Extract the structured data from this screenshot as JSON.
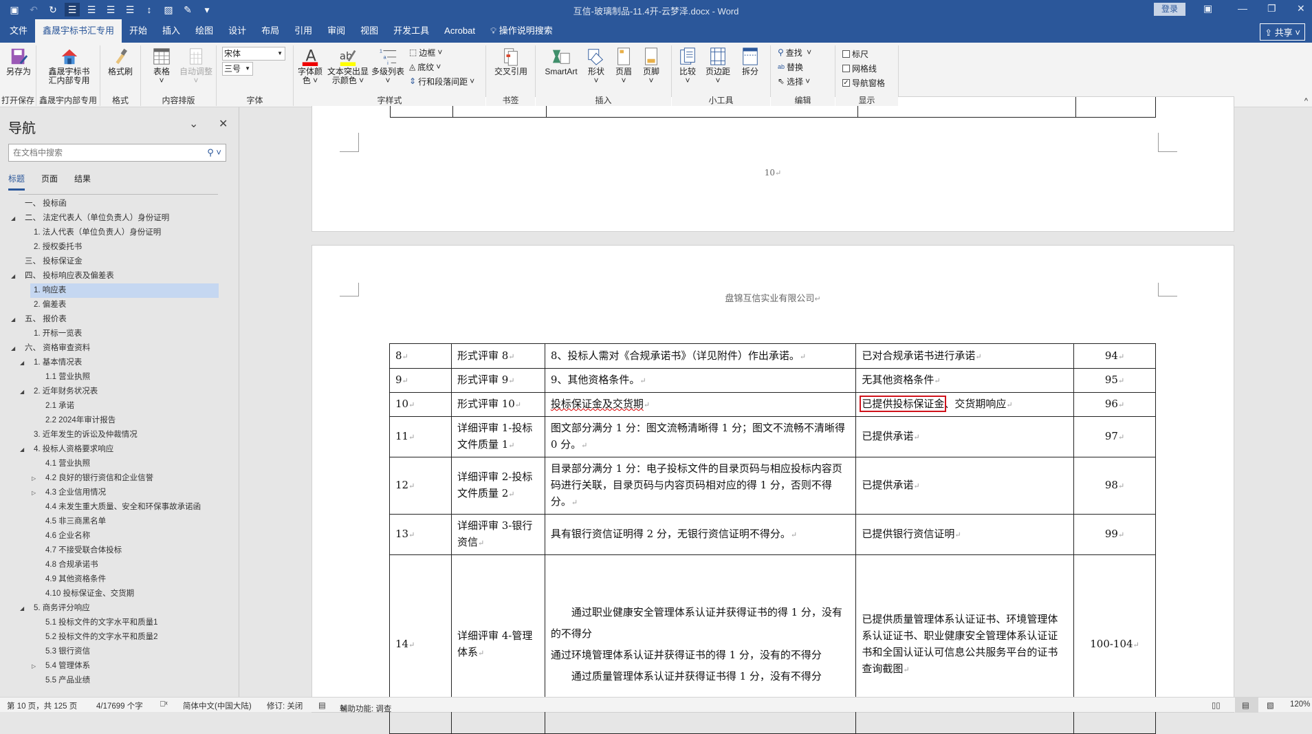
{
  "titlebar": {
    "document_title": "互信-玻璃制品-11.4开-云梦泽.docx - Word",
    "login": "登录"
  },
  "tabs": [
    "文件",
    "鑫晟宇标书汇专用",
    "开始",
    "插入",
    "绘图",
    "设计",
    "布局",
    "引用",
    "审阅",
    "视图",
    "开发工具",
    "Acrobat"
  ],
  "tell_me": "操作说明搜索",
  "share": "共享",
  "ribbon": {
    "save_as": "另存为",
    "xsy_label1": "鑫晟宇标书",
    "xsy_label2": "汇内部专用",
    "format_painter": "格式刷",
    "table": "表格",
    "auto_fit": "自动调整",
    "font_name": "宋体",
    "font_size": "三号",
    "font_color1": "字体颜",
    "font_color2": "色",
    "highlight1": "文本突出显",
    "highlight2": "示颜色",
    "multilevel": "多级列表",
    "border": "边框",
    "shading": "底纹",
    "line_spacing": "行和段落间距",
    "cross_ref": "交叉引用",
    "smartart": "SmartArt",
    "shape": "形状",
    "header": "页眉",
    "footer": "页脚",
    "compare": "比较",
    "margins": "页边距",
    "split": "拆分",
    "find": "查找",
    "replace": "替换",
    "select": "选择",
    "ruler": "标尺",
    "gridlines": "网格线",
    "nav_pane": "导航窗格",
    "groups": [
      "打开保存",
      "鑫晟宇内部专用",
      "格式",
      "内容排版",
      "字体",
      "字样式",
      "书签",
      "插入",
      "小工具",
      "编辑",
      "显示"
    ]
  },
  "nav": {
    "title": "导航",
    "search_placeholder": "在文档中搜索",
    "tabs": [
      "标题",
      "页面",
      "结果"
    ],
    "items": [
      {
        "t": "一、 投标函",
        "l": 0,
        "a": ""
      },
      {
        "t": "二、 法定代表人（单位负责人）身份证明",
        "l": 0,
        "a": "open"
      },
      {
        "t": "1. 法人代表（单位负责人）身份证明",
        "l": 1,
        "a": ""
      },
      {
        "t": "2. 授权委托书",
        "l": 1,
        "a": ""
      },
      {
        "t": "三、 投标保证金",
        "l": 0,
        "a": ""
      },
      {
        "t": "四、 投标响应表及偏差表",
        "l": 0,
        "a": "open"
      },
      {
        "t": "1. 响应表",
        "l": 1,
        "a": "",
        "sel": true
      },
      {
        "t": "2. 偏差表",
        "l": 1,
        "a": ""
      },
      {
        "t": "五、 报价表",
        "l": 0,
        "a": "open"
      },
      {
        "t": "1. 开标一览表",
        "l": 1,
        "a": ""
      },
      {
        "t": "六、 资格审查资料",
        "l": 0,
        "a": "open"
      },
      {
        "t": "1. 基本情况表",
        "l": 1,
        "a": "open"
      },
      {
        "t": "1.1 营业执照",
        "l": 2,
        "a": ""
      },
      {
        "t": "2. 近年财务状况表",
        "l": 1,
        "a": "open"
      },
      {
        "t": "2.1 承诺",
        "l": 2,
        "a": ""
      },
      {
        "t": "2.2 2024年审计报告",
        "l": 2,
        "a": ""
      },
      {
        "t": "3. 近年发生的诉讼及仲裁情况",
        "l": 1,
        "a": ""
      },
      {
        "t": "4. 投标人资格要求响应",
        "l": 1,
        "a": "open"
      },
      {
        "t": "4.1 营业执照",
        "l": 2,
        "a": ""
      },
      {
        "t": "4.2 良好的银行资信和企业信誉",
        "l": 2,
        "a": "closed"
      },
      {
        "t": "4.3 企业信用情况",
        "l": 2,
        "a": "closed"
      },
      {
        "t": "4.4 未发生重大质量、安全和环保事故承诺函",
        "l": 2,
        "a": ""
      },
      {
        "t": "4.5 非三商黑名单",
        "l": 2,
        "a": ""
      },
      {
        "t": "4.6 企业名称",
        "l": 2,
        "a": ""
      },
      {
        "t": "4.7 不接受联合体投标",
        "l": 2,
        "a": ""
      },
      {
        "t": "4.8 合规承诺书",
        "l": 2,
        "a": ""
      },
      {
        "t": "4.9 其他资格条件",
        "l": 2,
        "a": ""
      },
      {
        "t": "4.10 投标保证金、交货期",
        "l": 2,
        "a": ""
      },
      {
        "t": "5. 商务评分响应",
        "l": 1,
        "a": "open"
      },
      {
        "t": "5.1 投标文件的文字水平和质量1",
        "l": 2,
        "a": ""
      },
      {
        "t": "5.2 投标文件的文字水平和质量2",
        "l": 2,
        "a": ""
      },
      {
        "t": "5.3 银行资信",
        "l": 2,
        "a": ""
      },
      {
        "t": "5.4 管理体系",
        "l": 2,
        "a": "closed"
      },
      {
        "t": "5.5 产品业绩",
        "l": 2,
        "a": ""
      }
    ]
  },
  "document": {
    "page_number": "10",
    "header": "盘锦互信实业有限公司",
    "rows": [
      {
        "no": "8",
        "item": "形式评审 8",
        "req": "8、投标人需对《合规承诺书》（详见附件）作出承诺。",
        "resp": "已对合规承诺书进行承诺",
        "page": "94"
      },
      {
        "no": "9",
        "item": "形式评审 9",
        "req": "9、其他资格条件。",
        "resp": "无其他资格条件",
        "page": "95"
      },
      {
        "no": "10",
        "item": "形式评审 10",
        "req": "投标保证金及交货期",
        "resp_hl": "已提供投标保证金",
        "resp": "、交货期响应",
        "page": "96"
      },
      {
        "no": "11",
        "item": "详细评审 1-投标文件质量 1",
        "req": "图文部分满分 1 分：图文流畅清晰得 1 分；图文不流畅不清晰得 0 分。",
        "resp": "已提供承诺",
        "page": "97"
      },
      {
        "no": "12",
        "item": "详细评审 2-投标文件质量 2",
        "req": "目录部分满分 1 分：电子投标文件的目录页码与相应投标内容页码进行关联，目录页码与内容页码相对应的得 1 分，否则不得分。",
        "resp": "已提供承诺",
        "page": "98"
      },
      {
        "no": "13",
        "item": "详细评审 3-银行资信",
        "req": "具有银行资信证明得 2 分，无银行资信证明不得分。",
        "resp": "已提供银行资信证明",
        "page": "99"
      },
      {
        "no": "14",
        "item": "详细评审 4-管理体系",
        "req1": "通过职业健康安全管理体系认证并获得证书的得 1 分，没有的不得分",
        "req2": "通过环境管理体系认证并获得证书的得 1 分，没有的不得分",
        "req3": "通过质量管理体系认证并获得证书得 1 分，没有不得分",
        "resp": "已提供质量管理体系认证证书、环境管理体系认证证书、职业健康安全管理体系认证证书和全国认证认可信息公共服务平台的证书查询截图",
        "page": "100-104"
      }
    ]
  },
  "status": {
    "page": "第 10 页，共 125 页",
    "words": "4/17699 个字",
    "language": "简体中文(中国大陆)",
    "track": "修订: 关闭",
    "accessibility": "辅助功能: 调查",
    "zoom": "120%"
  }
}
